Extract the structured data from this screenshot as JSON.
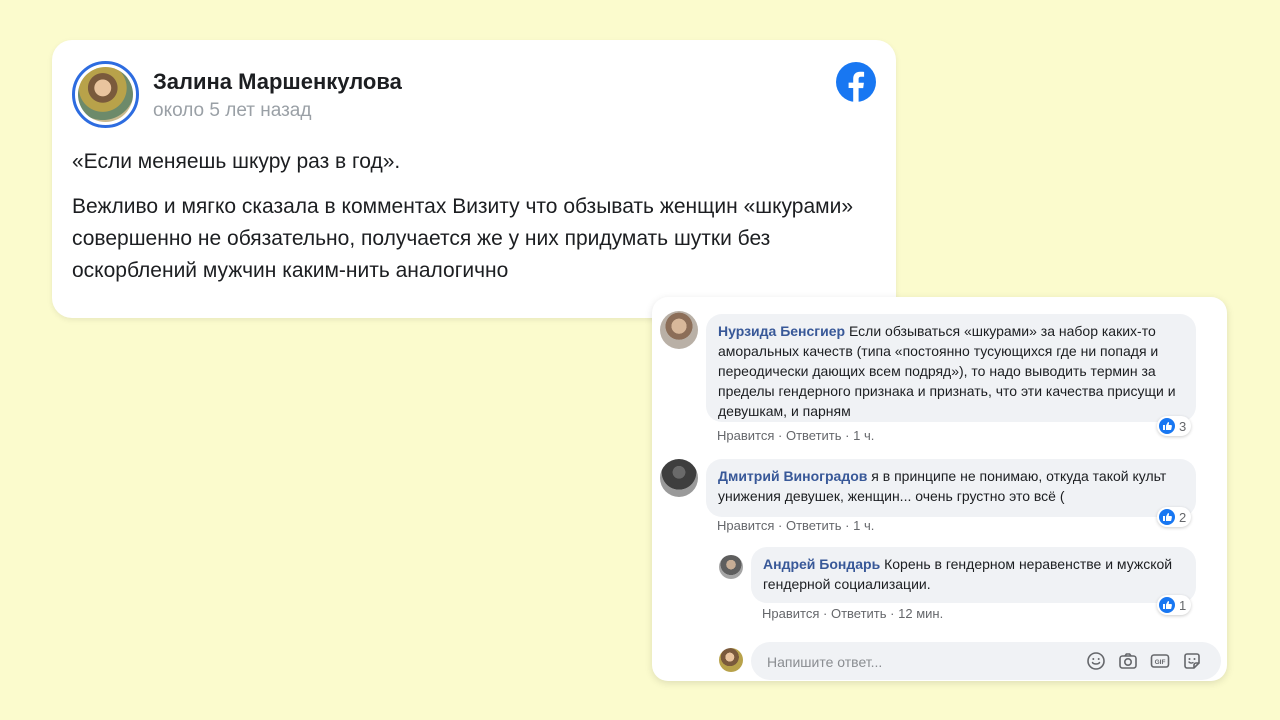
{
  "post": {
    "author": "Залина Маршенкулова",
    "time": "около 5 лет назад",
    "title": "«Если меняешь шкуру раз в год».",
    "body": "Вежливо и мягко сказала в комментах Визиту что обзывать женщин «шкурами» совершенно не обязательно, получается же у них придумать шутки без оскорблений мужчин каким-нить аналогично"
  },
  "comments": [
    {
      "name": "Нурзида Бенсгиер",
      "text": "Если обзываться «шкурами» за набор каких-то аморальных качеств (типа «постоянно тусующихся где ни попадя и переодически дающих всем подряд»), то надо выводить термин за пределы гендерного признака и признать, что эти качества присущи и девушкам, и парням",
      "like": "Нравится",
      "reply": "Ответить",
      "time": "1 ч.",
      "reactions": "3"
    },
    {
      "name": "Дмитрий Виноградов",
      "text": "я в принципе не понимаю, откуда такой культ унижения девушек, женщин... очень грустно это всё (",
      "like": "Нравится",
      "reply": "Ответить",
      "time": "1 ч.",
      "reactions": "2"
    },
    {
      "name": "Андрей Бондарь",
      "text": "Корень в гендерном неравенстве и мужской гендерной социализации.",
      "like": "Нравится",
      "reply": "Ответить",
      "time": "12 мин.",
      "reactions": "1"
    }
  ],
  "reply_input": {
    "placeholder": "Напишите ответ..."
  },
  "separator": "·",
  "icons": [
    "facebook-logo-icon",
    "like-icon",
    "emoji-icon",
    "camera-icon",
    "gif-icon",
    "sticker-icon"
  ],
  "colors": {
    "background": "#fbfbcd",
    "facebook_blue": "#1877f2",
    "comment_name": "#385898"
  }
}
